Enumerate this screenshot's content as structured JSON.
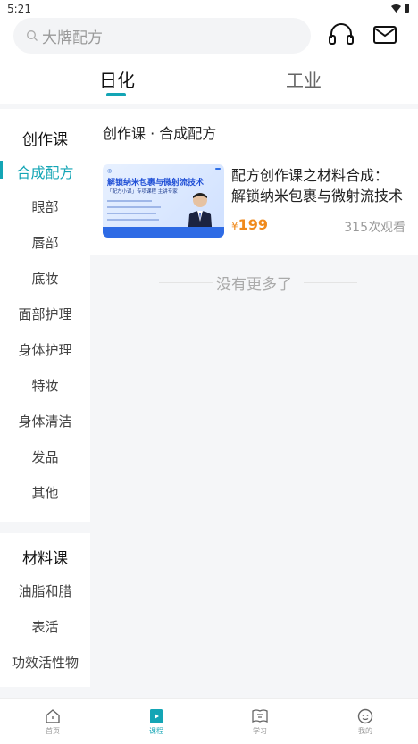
{
  "status_bar": {
    "time": "5:21"
  },
  "search": {
    "placeholder": "大牌配方"
  },
  "tabs": [
    {
      "label": "日化",
      "active": true
    },
    {
      "label": "工业",
      "active": false
    }
  ],
  "sidebar": {
    "sections": [
      {
        "title": "创作课",
        "items": [
          "合成配方",
          "眼部",
          "唇部",
          "底妆",
          "面部护理",
          "身体护理",
          "特妆",
          "身体清洁",
          "发品",
          "其他"
        ]
      },
      {
        "title": "材料课",
        "items": [
          "油脂和腊",
          "表活",
          "功效活性物"
        ]
      }
    ],
    "active_item": "合成配方"
  },
  "content": {
    "breadcrumb": "创作课 · 合成配方",
    "courses": [
      {
        "title_line1": "配方创作课之材料合成：",
        "title_line2": "解锁纳米包裹与微射流技术",
        "price_symbol": "¥",
        "price": "199",
        "views": "315次观看",
        "thumb_title": "解锁纳米包裹与微射流技术",
        "thumb_sub": "「配方小课」专项课程 主讲专家"
      }
    ],
    "no_more_text": "没有更多了"
  },
  "bottom_nav": [
    {
      "label": "首页",
      "icon": "home-icon",
      "active": false
    },
    {
      "label": "课程",
      "icon": "course-icon",
      "active": true
    },
    {
      "label": "学习",
      "icon": "book-icon",
      "active": false
    },
    {
      "label": "我的",
      "icon": "profile-icon",
      "active": false
    }
  ],
  "colors": {
    "accent": "#13a5b5",
    "price": "#f08a1c"
  }
}
